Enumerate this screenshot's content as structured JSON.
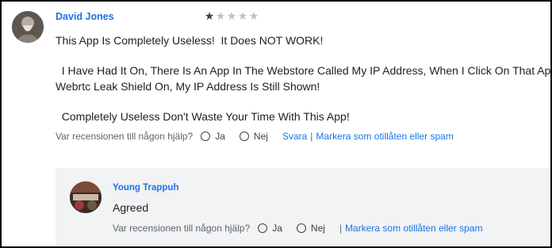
{
  "review": {
    "author": "David Jones",
    "rating": 1,
    "max_rating": 5,
    "paragraphs": [
      "This App Is Completely Useless!  It Does NOT WORK!",
      "  I Have Had It On, There Is An App In The Webstore Called My IP Address, When I Click On That App With",
      "Webrtc Leak Shield On, My IP Address Is Still Shown!",
      "  Completely Useless Don't Waste Your Time With This App!"
    ],
    "helpful_question": "Var recensionen till någon hjälp?",
    "yes_label": "Ja",
    "no_label": "Nej",
    "reply_link": "Svara",
    "separator": "|",
    "report_link": "Markera som otillåten eller spam"
  },
  "reply": {
    "author": "Young Trappuh",
    "text": "Agreed",
    "helpful_question": "Var recensionen till någon hjälp?",
    "yes_label": "Ja",
    "no_label": "Nej",
    "separator": "|",
    "report_link": "Markera som otillåten eller spam"
  },
  "icons": {
    "filled_star": "★",
    "empty_star": "★"
  },
  "colors": {
    "link": "#1a73e8",
    "text": "#202124",
    "muted": "#5f6368",
    "reply_bg": "#f1f3f4",
    "star_filled": "#3c4043",
    "star_empty": "#bdc1c6"
  }
}
